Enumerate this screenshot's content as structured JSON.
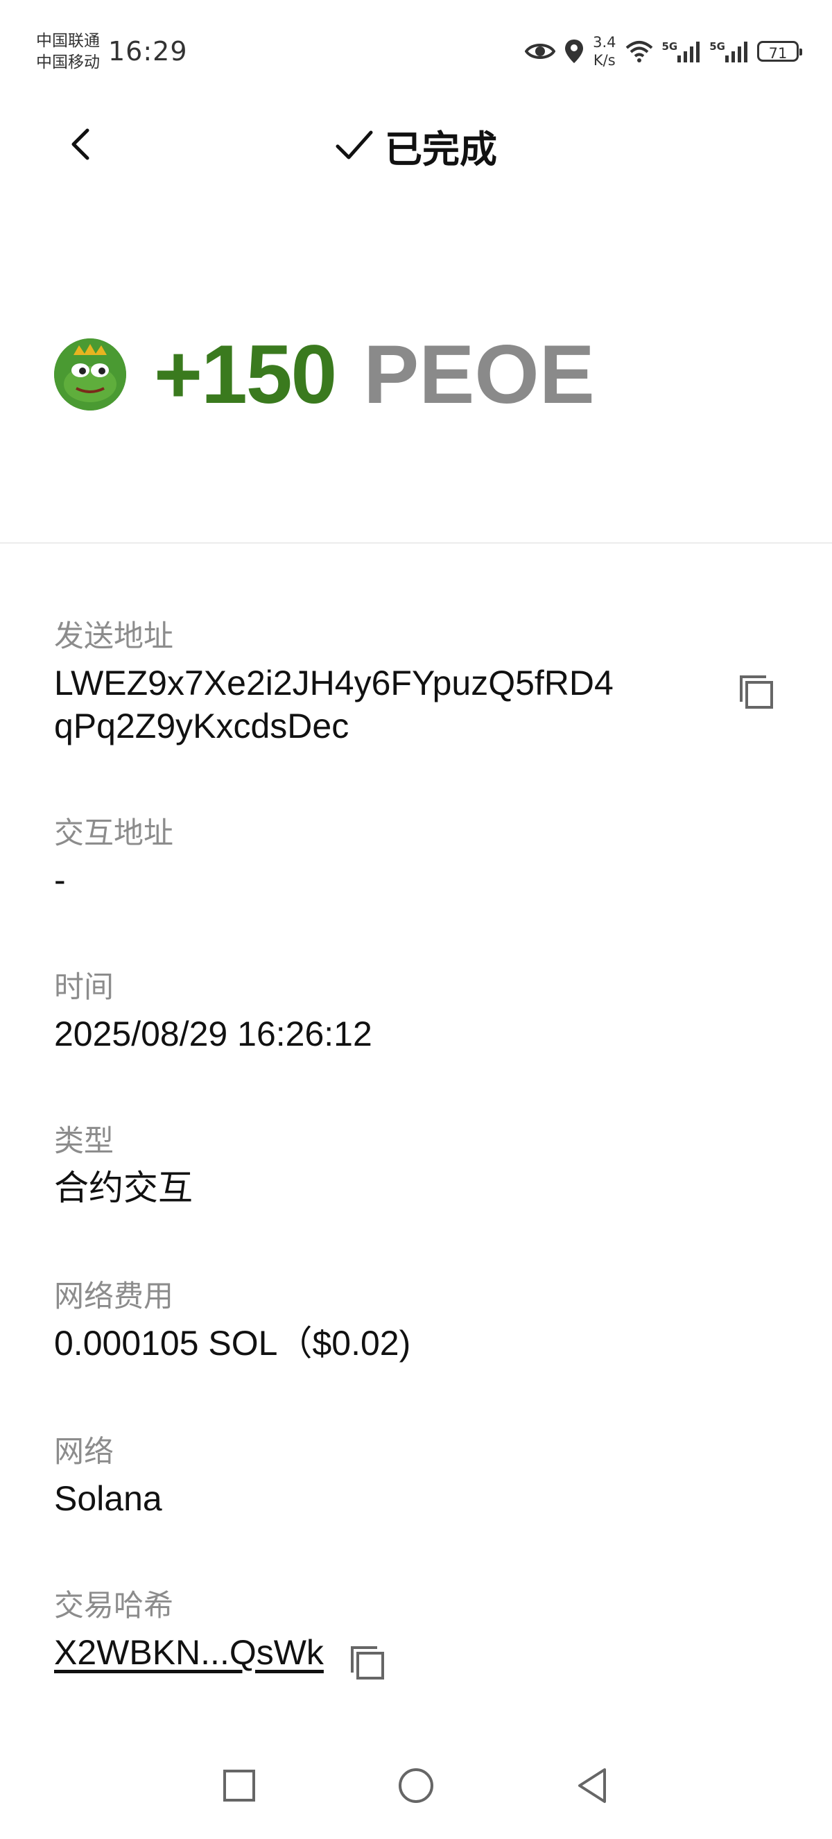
{
  "status_bar": {
    "carrier1": "中国联通",
    "carrier2": "中国移动",
    "time": "16:29",
    "speed_value": "3.4",
    "speed_unit": "K/s",
    "network1": "5G",
    "network2": "5G",
    "battery": "71"
  },
  "header": {
    "title": "已完成"
  },
  "amount": {
    "value": "+150",
    "unit": "PEOE"
  },
  "fields": {
    "sender_label": "发送地址",
    "sender_value": "LWEZ9x7Xe2i2JH4y6FYpuzQ5fRD4qPq2Z9yKxcdsDec",
    "interact_label": "交互地址",
    "interact_value": "-",
    "time_label": "时间",
    "time_value": "2025/08/29 16:26:12",
    "type_label": "类型",
    "type_value": "合约交互",
    "fee_label": "网络费用",
    "fee_value": "0.000105 SOL（$0.02)",
    "network_label": "网络",
    "network_value": "Solana",
    "hash_label": "交易哈希",
    "hash_value": "X2WBKN...QsWk"
  },
  "colors": {
    "amount_green": "#3a7a1e",
    "unit_gray": "#8a8a8a",
    "label_gray": "#8c8c8c"
  },
  "icons": [
    "back-arrow-icon",
    "check-icon",
    "copy-icon",
    "eye-icon",
    "location-icon",
    "wifi-icon",
    "signal-icon",
    "battery-icon",
    "nav-square-icon",
    "nav-circle-icon",
    "nav-back-icon"
  ]
}
